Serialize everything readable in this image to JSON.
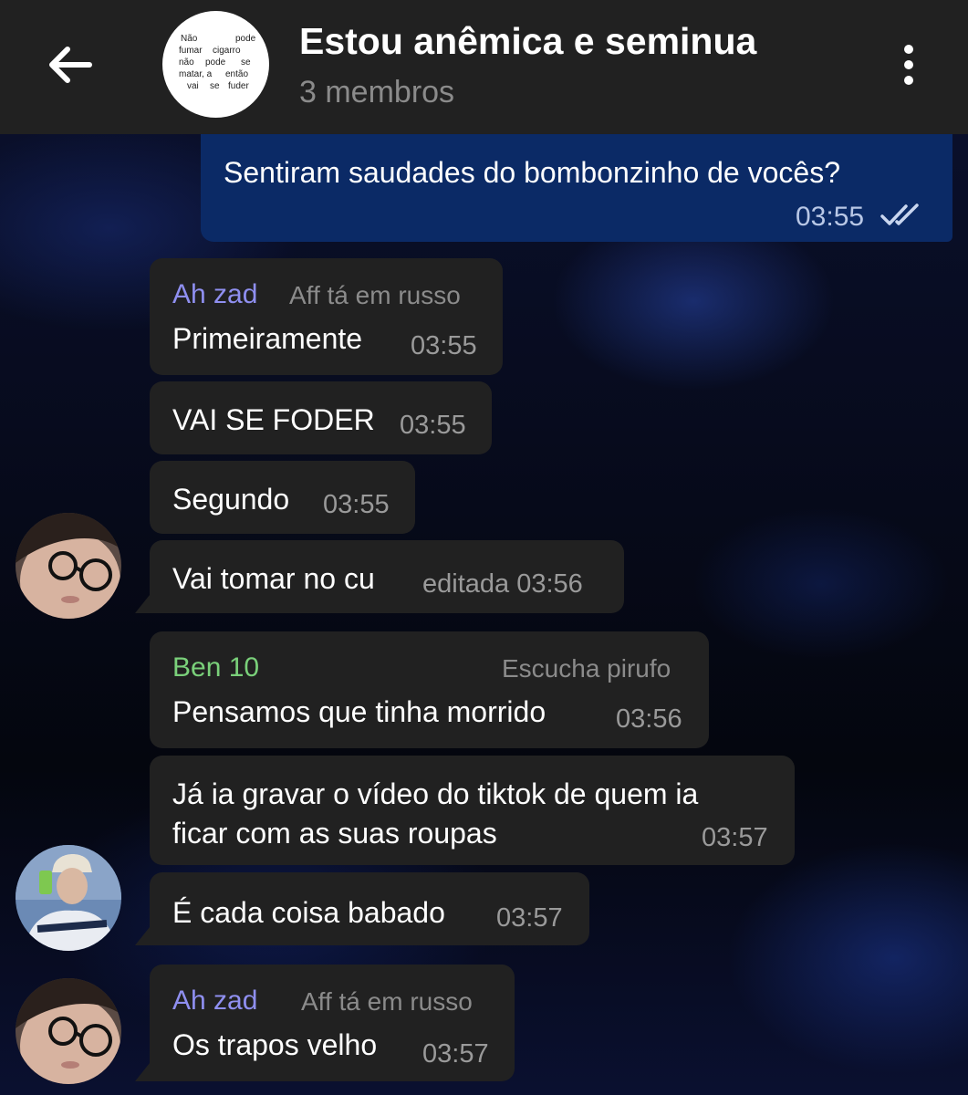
{
  "header": {
    "back_icon": "arrow-left-icon",
    "group_avatar_text": [
      "Não",
      "pode",
      "fumar",
      "cigarro",
      "não",
      "pode",
      "se",
      "matar, a",
      "então",
      "vai",
      "se",
      "fuder"
    ],
    "title": "Estou anêmica e seminua",
    "subtitle": "3 membros",
    "menu_icon": "more-vertical-icon"
  },
  "colors": {
    "header_bg": "#212121",
    "incoming_bubble": "#212121",
    "outgoing_bubble": "#0b2a66",
    "sender_ah_zad": "#8f8ff0",
    "sender_ben_10": "#7ad07a",
    "timestamp": "#9a9a9a"
  },
  "messages": [
    {
      "direction": "out",
      "text": "Sentiram saudades do bombonzinho de vocês?",
      "time": "03:55",
      "status_icon": "double-check-icon"
    },
    {
      "direction": "in",
      "sender": "Ah zad",
      "tag": "Aff tá em russo",
      "text": "Primeiramente",
      "time": "03:55"
    },
    {
      "direction": "in",
      "text": "VAI SE FODER",
      "time": "03:55"
    },
    {
      "direction": "in",
      "text": "Segundo",
      "time": "03:55"
    },
    {
      "direction": "in",
      "text": "Vai tomar no cu",
      "time": "editada 03:56"
    },
    {
      "direction": "in",
      "sender": "Ben 10",
      "tag": "Escucha pirufo",
      "text": "Pensamos que tinha morrido",
      "time": "03:56"
    },
    {
      "direction": "in",
      "text_line1": "Já ia gravar o vídeo do tiktok de quem ia",
      "text_line2": "ficar com as suas roupas",
      "time": "03:57"
    },
    {
      "direction": "in",
      "text": "É cada coisa babado",
      "time": "03:57"
    },
    {
      "direction": "in",
      "sender": "Ah zad",
      "tag": "Aff tá em russo",
      "text": "Os trapos velho",
      "time": "03:57"
    }
  ]
}
